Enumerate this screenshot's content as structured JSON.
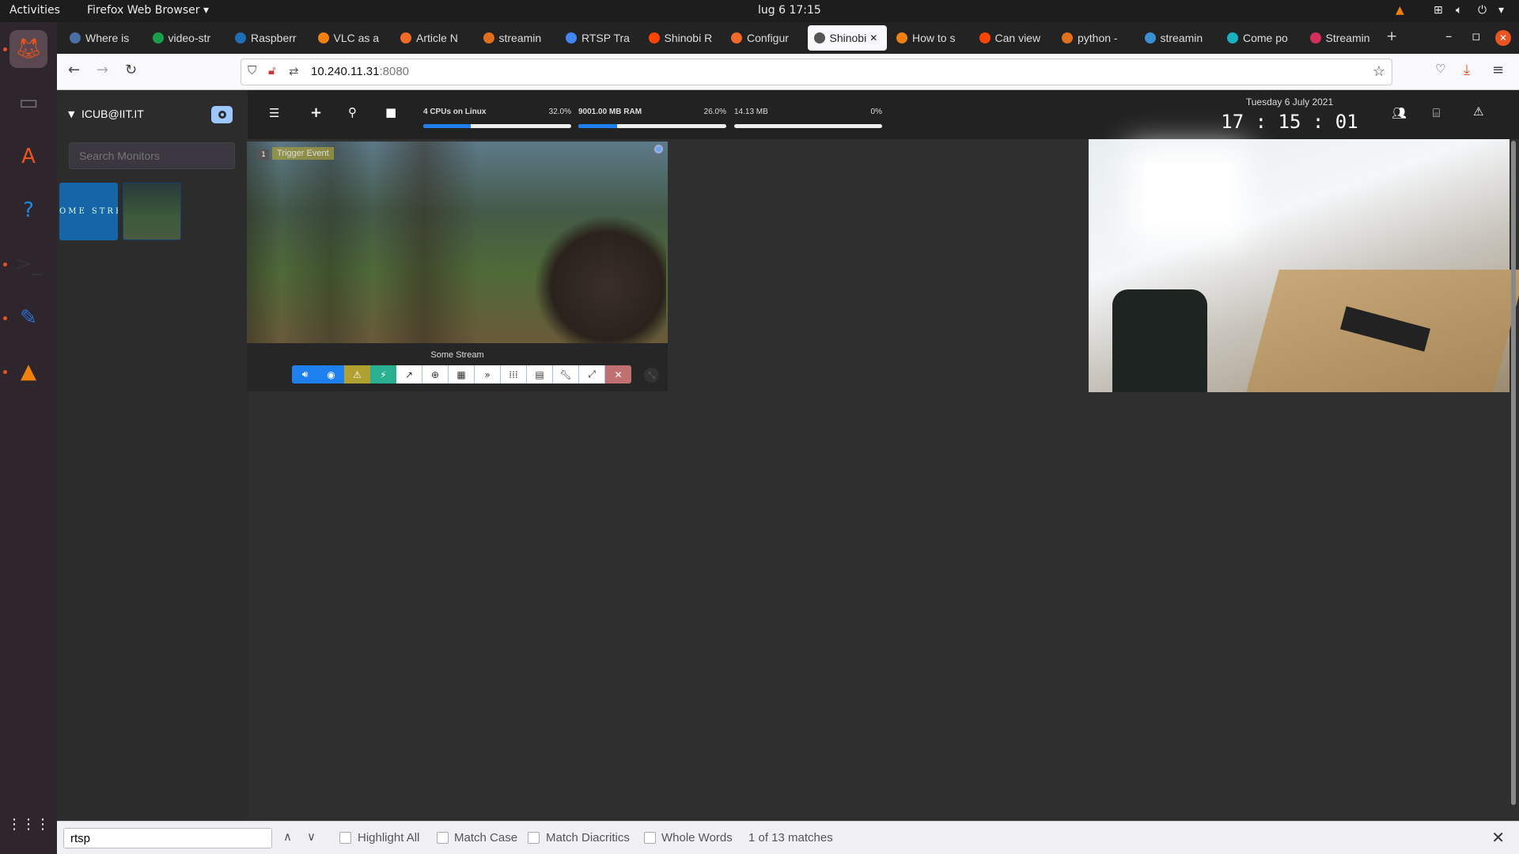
{
  "system": {
    "activities": "Activities",
    "app_menu": "Firefox Web Browser ▾",
    "clock": "lug 6  17:15"
  },
  "dock": [
    {
      "name": "firefox"
    },
    {
      "name": "files"
    },
    {
      "name": "software"
    },
    {
      "name": "help"
    },
    {
      "name": "terminal"
    },
    {
      "name": "text-editor"
    },
    {
      "name": "vlc"
    }
  ],
  "tabs": [
    {
      "label": "Where is",
      "color": "#4a6fa5"
    },
    {
      "label": "video-str",
      "color": "#1a9e4a"
    },
    {
      "label": "Raspberr",
      "color": "#1f6fb5"
    },
    {
      "label": "VLC as a",
      "color": "#f08010"
    },
    {
      "label": "Article N",
      "color": "#f06a2a"
    },
    {
      "label": "streamin",
      "color": "#e07020"
    },
    {
      "label": "RTSP Tra",
      "color": "#4285f4"
    },
    {
      "label": "Shinobi R",
      "color": "#ff4500"
    },
    {
      "label": "Configur",
      "color": "#f06a2a"
    },
    {
      "label": "Shinobi",
      "color": "#555",
      "active": true
    },
    {
      "label": "How to s",
      "color": "#f08010"
    },
    {
      "label": "Can view",
      "color": "#ff4500"
    },
    {
      "label": "python -",
      "color": "#e07020"
    },
    {
      "label": "streamin",
      "color": "#3a8fd0"
    },
    {
      "label": "Come po",
      "color": "#1ab0c0"
    },
    {
      "label": "Streamin",
      "color": "#d0305a"
    }
  ],
  "nav": {
    "url_host": "10.240.11.31",
    "url_port": ":8080"
  },
  "sidebar": {
    "user": "ICUB@IIT.IT",
    "search_placeholder": "Search Monitors",
    "thumb1_text": "OME STREA"
  },
  "header": {
    "cpu": {
      "label": "4 CPUs on Linux",
      "value": "32.0%",
      "percent": 32
    },
    "ram": {
      "label": "9001.00 MB RAM",
      "value": "26.0%",
      "percent": 26
    },
    "disk": {
      "label": "14.13 MB",
      "value": "0%",
      "percent": 0
    },
    "date": "Tuesday 6 July 2021",
    "time": "17 : 15 : 01"
  },
  "monitor": {
    "id": "1",
    "trigger": "Trigger Event",
    "title": "Some Stream"
  },
  "controls": [
    "volume",
    "camera",
    "warning",
    "plug",
    "external-link",
    "zoom-in",
    "calendar",
    "forward",
    "grid",
    "film",
    "wrench",
    "expand",
    "close"
  ],
  "accent": "#1e7fef",
  "find": {
    "query": "rtsp",
    "highlight_all": "Highlight All",
    "match_case": "Match Case",
    "match_diacritics": "Match Diacritics",
    "whole_words": "Whole Words",
    "status": "1 of 13 matches"
  }
}
